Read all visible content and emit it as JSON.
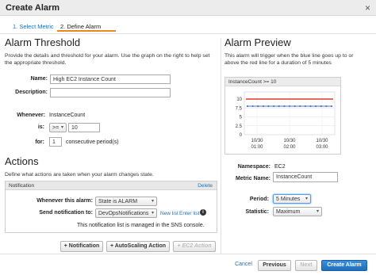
{
  "window": {
    "title": "Create Alarm"
  },
  "steps": {
    "step1": "1. Select Metric",
    "step2": "2. Define Alarm"
  },
  "threshold": {
    "heading": "Alarm Threshold",
    "description": "Provide the details and threshold for your alarm. Use the graph on the right to help set the appropriate threshold.",
    "name_label": "Name:",
    "name_value": "High EC2 Instance Count",
    "description_label": "Description:",
    "description_value": "",
    "whenever_label": "Whenever:",
    "whenever_value": "InstanceCount",
    "is_label": "is:",
    "operator_value": ">=",
    "threshold_value": "10",
    "for_label": "for:",
    "periods_value": "1",
    "periods_suffix": "consecutive period(s)"
  },
  "actions": {
    "heading": "Actions",
    "description": "Define what actions are taken when your alarm changes state.",
    "notification": {
      "header": "Notification",
      "delete_label": "Delete",
      "state_label": "Whenever this alarm:",
      "state_value": "State is ALARM",
      "send_label": "Send notification to:",
      "send_value": "DevOpsNotifications",
      "new_list_link": "New list",
      "enter_list_link": "Enter list",
      "info_icon": "info-icon",
      "sns_note": "This notification list is managed in the SNS console."
    },
    "buttons": {
      "add_notification": "+ Notification",
      "add_autoscaling": "+ AutoScaling Action",
      "add_ec2": "+ EC2 Action"
    }
  },
  "preview": {
    "heading": "Alarm Preview",
    "description": "This alarm will trigger when the blue line goes up to or above the red line for a duration of 5 minutes",
    "chart_title": "InstanceCount >= 10",
    "namespace_label": "Namespace:",
    "namespace_value": "EC2",
    "metric_label": "Metric Name:",
    "metric_value": "InstanceCount",
    "period_label": "Period:",
    "period_value": "5 Minutes",
    "statistic_label": "Statistic:",
    "statistic_value": "Maximum"
  },
  "chart_data": {
    "type": "line",
    "title": "InstanceCount >= 10",
    "y_ticks": [
      "10",
      "7.5",
      "5",
      "2.5",
      "0"
    ],
    "x_ticks": [
      {
        "date": "10/30",
        "time": "01:00"
      },
      {
        "date": "10/30",
        "time": "02:00"
      },
      {
        "date": "10/30",
        "time": "03:00"
      }
    ],
    "ylim": [
      0,
      12
    ],
    "threshold": 10,
    "threshold_color": "#e03a2f",
    "series": [
      {
        "color": "#4a78c7",
        "values": [
          8,
          8,
          8,
          8,
          8,
          8,
          8,
          8,
          8,
          8,
          8,
          8,
          8,
          8,
          8,
          8,
          8
        ]
      }
    ],
    "grid": true
  },
  "footer": {
    "cancel": "Cancel",
    "previous": "Previous",
    "next": "Next",
    "create": "Create Alarm"
  }
}
